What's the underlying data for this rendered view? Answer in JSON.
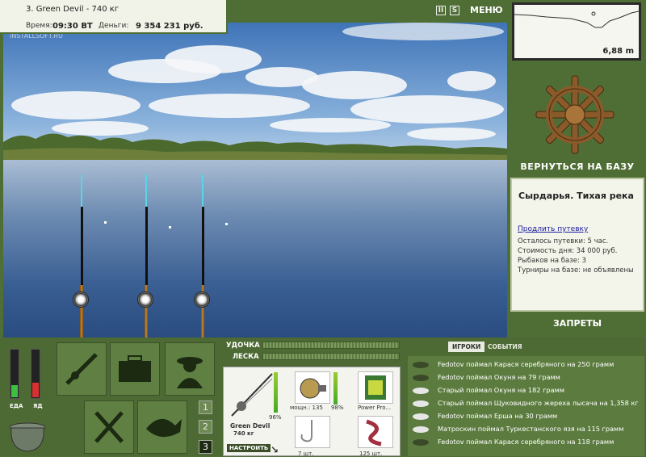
{
  "header": {
    "title": "3. Green Devil - 740 кг",
    "time_label": "Время:",
    "time_value": "09:30 ВТ",
    "money_label": "Деньги:",
    "money_value": "9 354 231 руб."
  },
  "watermark": "INSTALLSOFT.RU",
  "top_controls": {
    "pause_label": "II",
    "sound_label": "S",
    "menu_label": "МЕНЮ"
  },
  "depth": {
    "value": "6,88 m"
  },
  "return_label": "ВЕРНУТЬСЯ НА БАЗУ",
  "location": {
    "title": "Сырдарья. Тихая река",
    "extend_link": "Продлить путевку",
    "lines": [
      "Осталось путевки: 5 час.",
      "Стоимость дня: 34 000 руб.",
      "Рыбаков на базе: 3",
      "Турниры на базе: не объявлены"
    ]
  },
  "bans_label": "ЗАПРЕТЫ",
  "gauges": {
    "food_label": "ЕДА",
    "poison_label": "ЯД",
    "food_level": 0.25,
    "poison_level": 0.3,
    "food_color": "#3fbf3f",
    "poison_color": "#d83030"
  },
  "rod_slots": [
    "1",
    "2",
    "3"
  ],
  "bars": {
    "rod_label": "УДОЧКА",
    "line_label": "ЛЕСКА"
  },
  "gear": {
    "rod_name": "Green Devil",
    "rod_weight": "740 кг",
    "rod_percent": "96%",
    "setup_button": "НАСТРОИТЬ",
    "reel_power": "мощн.: 135",
    "reel_percent": "98%",
    "line_name": "Power Pro...",
    "hook_count": "7 шт.",
    "bait_count": "125 шт."
  },
  "log": {
    "tabs": [
      "ИГРОКИ",
      "СОБЫТИЯ"
    ],
    "entries": [
      {
        "text": "Fedotov поймал Карася серебряного на 250 грамм",
        "fish_color": "#3a4a28"
      },
      {
        "text": "Fedotov поймал Окуня на 79 грамм",
        "fish_color": "#3a4a28"
      },
      {
        "text": "Старый поймал Окуня на 182 грамм",
        "fish_color": "#e6e6e6"
      },
      {
        "text": "Старый поймал Щуковидного жереха лысача на 1,358 кг",
        "fish_color": "#e6e6e6"
      },
      {
        "text": "Fedotov поймал Ерша на 30 грамм",
        "fish_color": "#e6e6e6"
      },
      {
        "text": "Матроскин поймал Туркестанского язя на 115 грамм",
        "fish_color": "#e6e6e6"
      },
      {
        "text": "Fedotov поймал Карася серебряного на 118 грамм",
        "fish_color": "#3a4a28"
      }
    ]
  }
}
